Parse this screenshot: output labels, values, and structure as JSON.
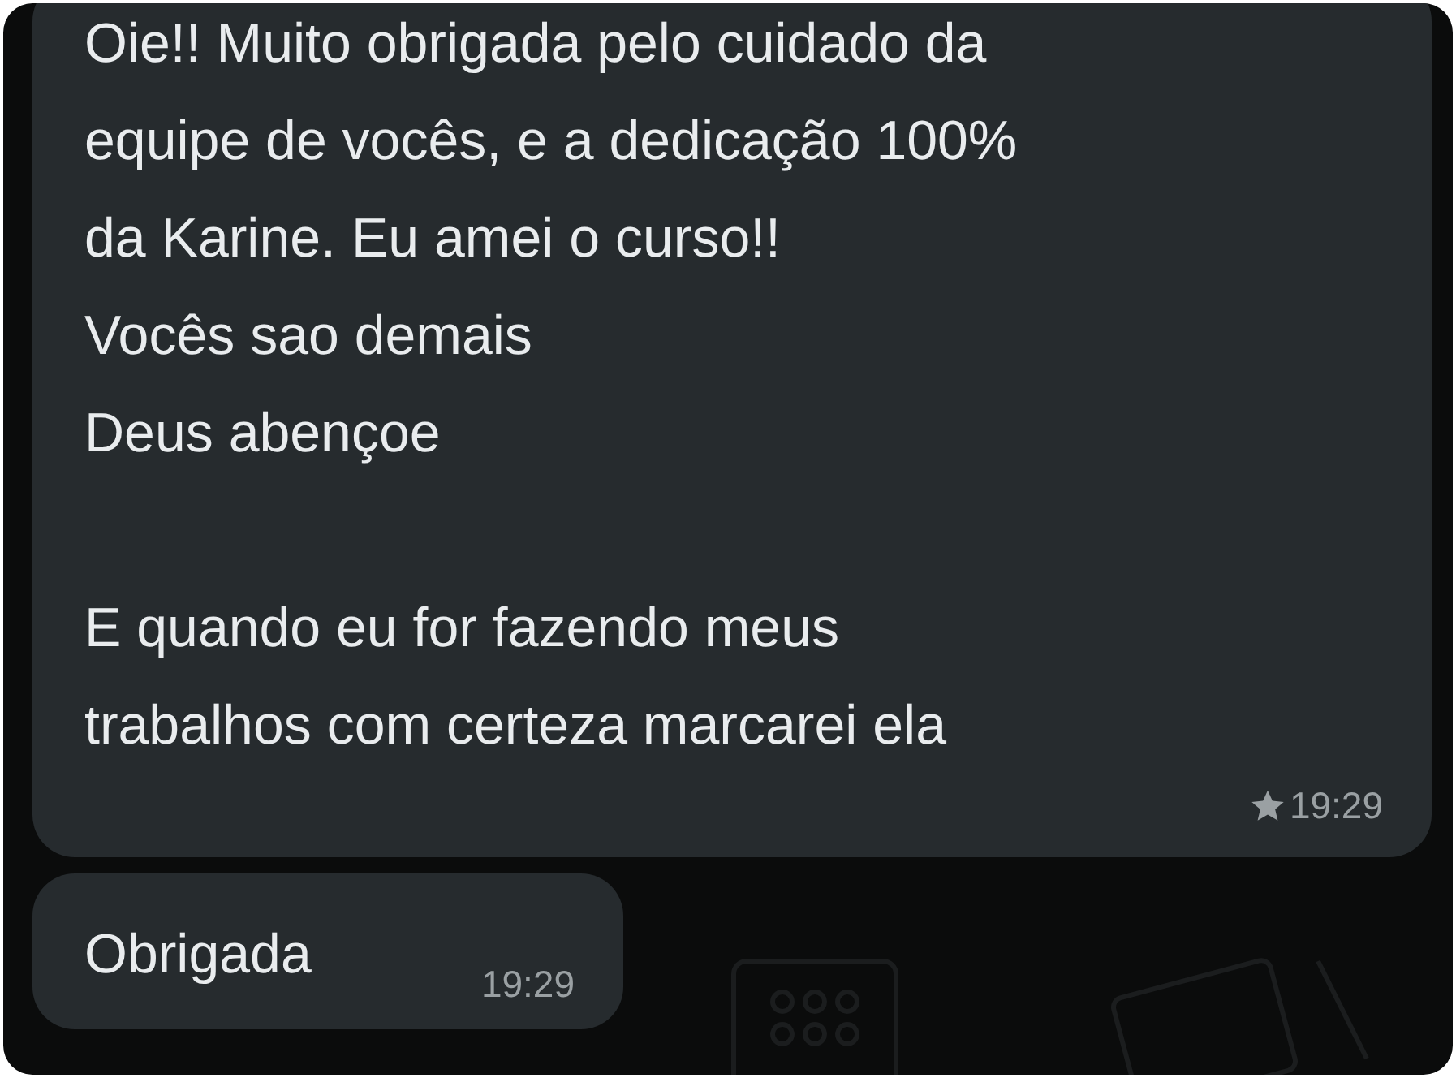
{
  "messages": [
    {
      "kind": "incoming",
      "paragraphs": [
        [
          "Oie!! Muito obrigada pelo cuidado da",
          "equipe de vocês, e a dedicação 100%",
          "da Karine. Eu amei o curso!!",
          "Vocês sao demais",
          "Deus abençoe"
        ],
        [
          "E quando eu for fazendo meus",
          "trabalhos com certeza marcarei ela"
        ]
      ],
      "time": "19:29",
      "starred": true
    },
    {
      "kind": "incoming",
      "paragraphs": [
        [
          "Obrigada"
        ]
      ],
      "time": "19:29",
      "starred": false
    }
  ]
}
